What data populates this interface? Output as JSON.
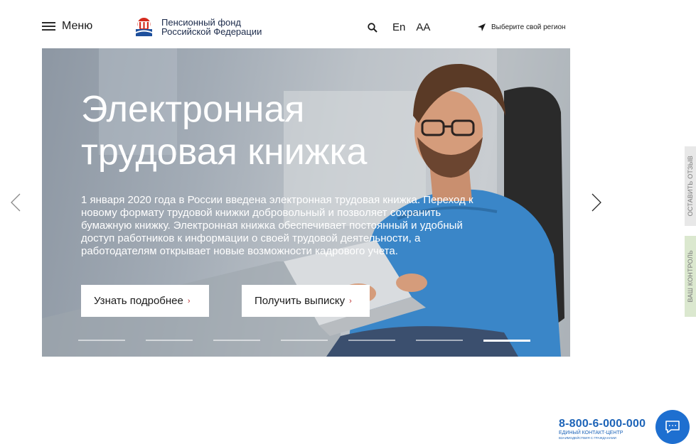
{
  "header": {
    "menu_label": "Меню",
    "logo_line1": "Пенсионный фонд",
    "logo_line2": "Российской Федерации",
    "lang_label": "En",
    "font_size_label": "АА",
    "region_label": "Выберите свой регион"
  },
  "hero": {
    "title_line1": "Электронная",
    "title_line2": "трудовая книжка",
    "description": "1 января 2020 года в России введена электронная трудовая книжка. Переход к новому формату трудовой книжки добровольный и позволяет сохранить бумажную книжку. Электронная книжка обеспечивает постоянный и удобный доступ работников к информации о своей трудовой деятельности, а работодателям открывает новые возможности кадрового учета.",
    "button_more": "Узнать подробнее",
    "button_extract": "Получить выписку",
    "slides_total": 7,
    "slide_active": 7
  },
  "side_tabs": {
    "feedback": "ОСТАВИТЬ ОТЗЫВ",
    "control": "ВАШ КОНТРОЛЬ"
  },
  "contact": {
    "phone": "8-800-6-000-000",
    "line1": "ЕДИНЫЙ КОНТАКТ-ЦЕНТР",
    "line2": "ВЗАИМОДЕЙСТВИЯ С ГРАЖДАНАМИ"
  },
  "colors": {
    "accent": "#1d64b8",
    "chat_button": "#1e6fd0",
    "logo_red": "#d52b1e",
    "logo_blue": "#1d4f9c"
  },
  "icons": {
    "menu": "hamburger-icon",
    "search": "search-icon",
    "region": "location-arrow-icon",
    "prev": "chevron-left-icon",
    "next": "chevron-right-icon",
    "chat": "chat-bubble-icon"
  }
}
